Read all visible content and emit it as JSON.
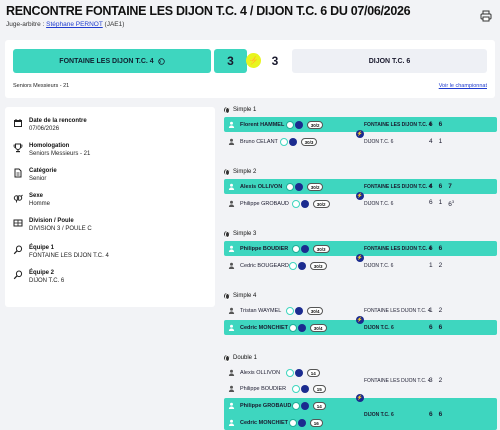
{
  "header": {
    "title": "RENCONTRE FONTAINE LES DIJON T.C. 4 / DIJON T.C. 6 DU 07/06/2026",
    "judge_label": "Juge-arbitre :",
    "judge_name": "Stéphane PERNOT",
    "judge_code": "(JAE1)"
  },
  "score": {
    "home_team": "FONTAINE LES DIJON T.C. 4",
    "home_score": "3",
    "away_score": "3",
    "away_team": "DIJON T.C. 6",
    "category": "Seniors Messieurs - 21",
    "champ_link": "Voir le championnat"
  },
  "info": [
    {
      "icon": "calendar-icon",
      "label": "Date de la rencontre",
      "value": "07/06/2026"
    },
    {
      "icon": "trophy-icon",
      "label": "Homologation",
      "value": "Seniors Messieurs - 21"
    },
    {
      "icon": "document-icon",
      "label": "Catégorie",
      "value": "Senior"
    },
    {
      "icon": "gender-icon",
      "label": "Sexe",
      "value": "Homme"
    },
    {
      "icon": "division-icon",
      "label": "Division / Poule",
      "value": "DIVISION 3 / POULE C"
    },
    {
      "icon": "racket-icon",
      "label": "Équipe 1",
      "value": "FONTAINE LES DIJON T.C. 4"
    },
    {
      "icon": "racket-icon",
      "label": "Équipe 2",
      "value": "DIJON T.C. 6"
    }
  ],
  "matches": [
    {
      "title": "Simple 1",
      "rows": [
        {
          "name": "Florent HAMMEL",
          "rank": "30/2",
          "club": "FONTAINE LES DIJON T.C. 4",
          "sets": [
            "6",
            "6"
          ],
          "win": true
        },
        {
          "name": "Bruno CELANT",
          "rank": "30/3",
          "club": "DIJON T.C. 6",
          "sets": [
            "4",
            "1"
          ],
          "win": false
        }
      ]
    },
    {
      "title": "Simple 2",
      "rows": [
        {
          "name": "Alexis OLLIVON",
          "rank": "30/2",
          "club": "FONTAINE LES DIJON T.C. 4",
          "sets": [
            "4",
            "6",
            "7"
          ],
          "win": true
        },
        {
          "name": "Philippe GROBAUD",
          "rank": "30/2",
          "club": "DIJON T.C. 6",
          "sets": [
            "6",
            "1",
            "6"
          ],
          "sup": "3",
          "win": false
        }
      ]
    },
    {
      "title": "Simple 3",
      "rows": [
        {
          "name": "Philippe BOUDIER",
          "rank": "30/3",
          "club": "FONTAINE LES DIJON T.C. 4",
          "sets": [
            "6",
            "6"
          ],
          "win": true
        },
        {
          "name": "Cedric BOUGEARD",
          "rank": "30/3",
          "club": "DIJON T.C. 6",
          "sets": [
            "1",
            "2"
          ],
          "win": false
        }
      ]
    },
    {
      "title": "Simple 4",
      "rows": [
        {
          "name": "Tristan WAYMEL",
          "rank": "30/4",
          "club": "FONTAINE LES DIJON T.C. 4",
          "sets": [
            "1",
            "2"
          ],
          "win": false
        },
        {
          "name": "Cedric MONCHIET",
          "rank": "30/4",
          "club": "DIJON T.C. 6",
          "sets": [
            "6",
            "6"
          ],
          "win": true
        }
      ]
    }
  ],
  "double": {
    "title": "Double 1",
    "home": {
      "p1": "Alexis OLLIVON",
      "r1": "14",
      "p2": "Philippe BOUDIER",
      "r2": "15",
      "club": "FONTAINE LES DIJON T.C. 4",
      "sets": [
        "3",
        "2"
      ]
    },
    "away": {
      "p1": "Philippe GROBAUD",
      "r1": "14",
      "p2": "Cedric MONCHIET",
      "r2": "16",
      "club": "DIJON T.C. 6",
      "sets": [
        "6",
        "6"
      ]
    }
  },
  "colors": {
    "accent": "#3ed6bf",
    "navy": "#1b2b8f",
    "bolt": "#e8f51e"
  }
}
